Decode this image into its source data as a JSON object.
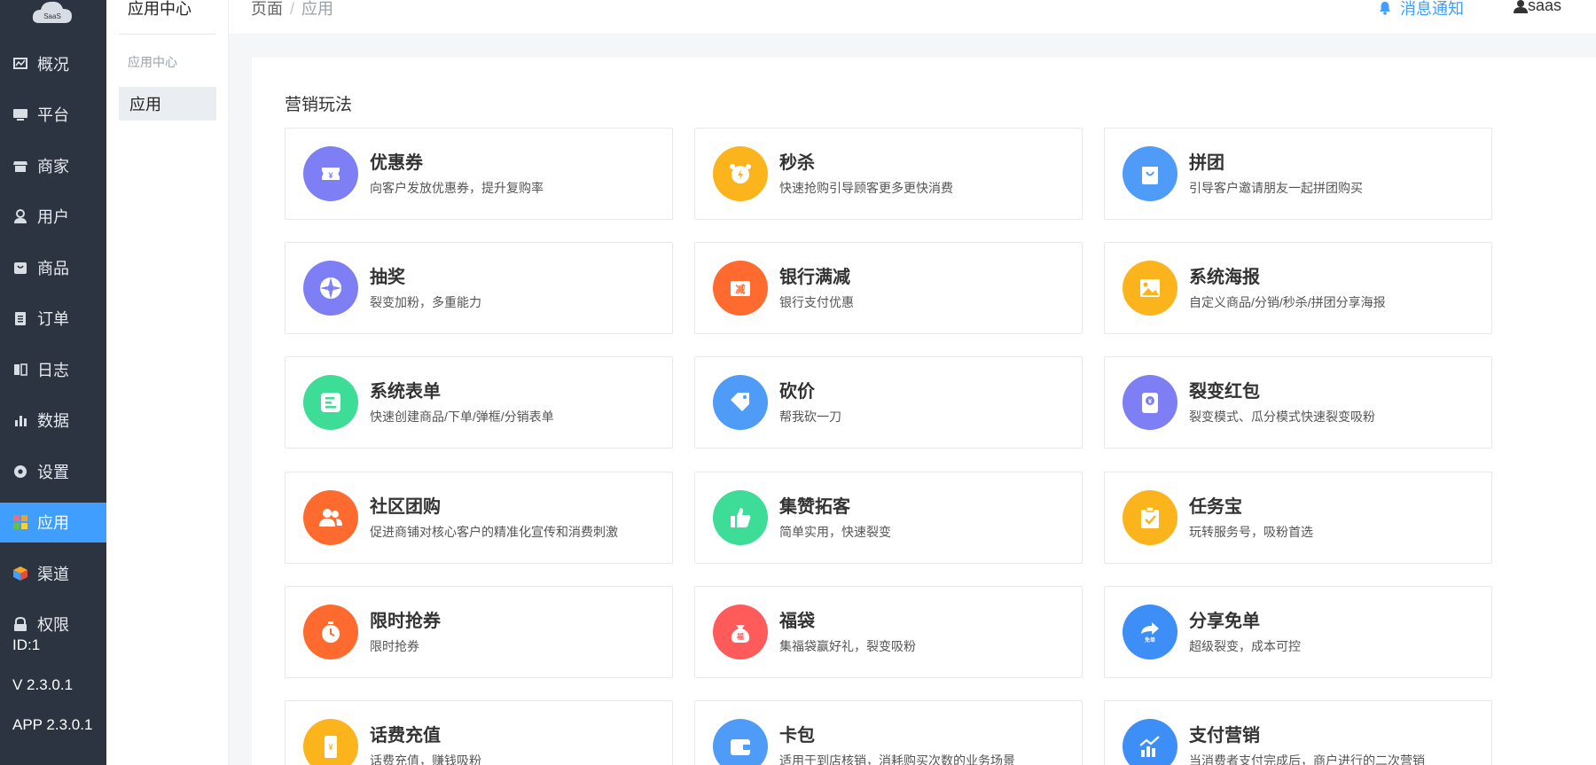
{
  "logo": {
    "text": "SaaS"
  },
  "sidebar": {
    "items": [
      {
        "label": "概况",
        "icon": "overview-icon"
      },
      {
        "label": "平台",
        "icon": "monitor-icon"
      },
      {
        "label": "商家",
        "icon": "store-icon"
      },
      {
        "label": "用户",
        "icon": "user-icon"
      },
      {
        "label": "商品",
        "icon": "goods-icon"
      },
      {
        "label": "订单",
        "icon": "order-icon"
      },
      {
        "label": "日志",
        "icon": "log-icon"
      },
      {
        "label": "数据",
        "icon": "chart-icon"
      },
      {
        "label": "设置",
        "icon": "gear-icon"
      },
      {
        "label": "应用",
        "icon": "apps-icon",
        "active": true
      },
      {
        "label": "渠道",
        "icon": "cube-icon"
      },
      {
        "label": "权限",
        "icon": "lock-icon"
      }
    ],
    "footer": {
      "id": "ID:1",
      "version": "V 2.3.0.1",
      "app_version": "APP 2.3.0.1"
    }
  },
  "subnav": {
    "title": "应用中心",
    "group": "应用中心",
    "item": "应用"
  },
  "topbar": {
    "breadcrumb": [
      "页面",
      "应用"
    ],
    "separator": "/",
    "notify_label": "消息通知",
    "user_name": "saas"
  },
  "section": {
    "title": "营销玩法"
  },
  "cards": [
    {
      "name": "优惠券",
      "desc": "向客户发放优惠券，提升复购率",
      "color": "#7e7ff5",
      "icon": "coupon-icon",
      "glyph": "¥"
    },
    {
      "name": "秒杀",
      "desc": "快速抢购引导顾客更多更快消费",
      "color": "#fbb41c",
      "icon": "alarm-clock-icon",
      "glyph": ""
    },
    {
      "name": "拼团",
      "desc": "引导客户邀请朋友一起拼团购买",
      "color": "#4f9cf8",
      "icon": "shopping-bag-icon",
      "glyph": ""
    },
    {
      "name": "抽奖",
      "desc": "裂变加粉，多重能力",
      "color": "#7e7ff5",
      "icon": "lottery-wheel-icon",
      "glyph": ""
    },
    {
      "name": "银行满减",
      "desc": "银行支付优惠",
      "color": "#ff6b2f",
      "icon": "bank-discount-icon",
      "glyph": "减"
    },
    {
      "name": "系统海报",
      "desc": "自定义商品/分销/秒杀/拼团分享海报",
      "color": "#fbb41c",
      "icon": "poster-image-icon",
      "glyph": ""
    },
    {
      "name": "系统表单",
      "desc": "快速创建商品/下单/弹框/分销表单",
      "color": "#3ddc97",
      "icon": "form-icon",
      "glyph": ""
    },
    {
      "name": "砍价",
      "desc": "帮我砍一刀",
      "color": "#4f9cf8",
      "icon": "price-tag-icon",
      "glyph": ""
    },
    {
      "name": "裂变红包",
      "desc": "裂变模式、瓜分模式快速裂变吸粉",
      "color": "#7e7ff5",
      "icon": "red-packet-icon",
      "glyph": "¥"
    },
    {
      "name": "社区团购",
      "desc": "促进商铺对核心客户的精准化宣传和消费刺激",
      "color": "#ff6b2f",
      "icon": "community-group-icon",
      "glyph": ""
    },
    {
      "name": "集赞拓客",
      "desc": "简单实用，快速裂变",
      "color": "#3ddc97",
      "icon": "thumbs-up-icon",
      "glyph": ""
    },
    {
      "name": "任务宝",
      "desc": "玩转服务号，吸粉首选",
      "color": "#fbb41c",
      "icon": "clipboard-check-icon",
      "glyph": ""
    },
    {
      "name": "限时抢券",
      "desc": "限时抢券",
      "color": "#ff6b2f",
      "icon": "timer-icon",
      "glyph": ""
    },
    {
      "name": "福袋",
      "desc": "集福袋赢好礼，裂变吸粉",
      "color": "#ff5b5b",
      "icon": "lucky-bag-icon",
      "glyph": "福"
    },
    {
      "name": "分享免单",
      "desc": "超级裂变，成本可控",
      "color": "#3d8ef7",
      "icon": "share-free-icon",
      "glyph": "免单"
    },
    {
      "name": "话费充值",
      "desc": "话费充值，赚钱吸粉",
      "color": "#fbb41c",
      "icon": "phone-recharge-icon",
      "glyph": "¥"
    },
    {
      "name": "卡包",
      "desc": "适用于到店核销，消耗购买次数的业务场景",
      "color": "#4f9cf8",
      "icon": "wallet-icon",
      "glyph": ""
    },
    {
      "name": "支付营销",
      "desc": "当消费者支付完成后，商户进行的二次营销",
      "color": "#3d8ef7",
      "icon": "growth-chart-icon",
      "glyph": ""
    }
  ]
}
